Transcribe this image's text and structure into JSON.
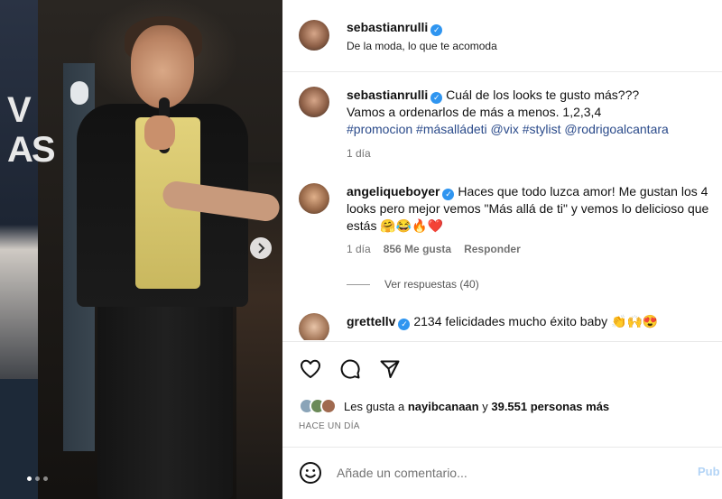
{
  "media": {
    "watermark": "V\nAS",
    "next_icon": "chevron-right-icon",
    "carousel_total": 3,
    "carousel_active": 1
  },
  "header": {
    "username": "sebastianrulli",
    "subtitle": "De la moda, lo que te acomoda"
  },
  "caption": {
    "username": "sebastianrulli",
    "text_1": "Cuál de los looks te gusto más???",
    "text_2": "Vamos a ordenarlos de más a menos. 1,2,3,4",
    "tags": "#promocion #másalládeti @vix #stylist @rodrigoalcantara",
    "time": "1 día"
  },
  "comment1": {
    "username": "angeliqueboyer",
    "text": "Haces que todo luzca amor! Me gustan los 4 looks pero mejor vemos \"Más allá de ti\" y vemos lo delicioso que estás 🤗😂🔥❤️",
    "time": "1 día",
    "likes": "856 Me gusta",
    "reply": "Responder",
    "view_replies": "Ver respuestas (40)"
  },
  "comment2": {
    "username": "grettellv",
    "text": "2134 felicidades mucho éxito baby 👏🙌😍"
  },
  "likes": {
    "prefix": "Les gusta a",
    "user": "nayibcanaan",
    "middle": "y",
    "count": "39.551 personas más"
  },
  "timestamp": "HACE UN DÍA",
  "comment_box": {
    "placeholder": "Añade un comentario...",
    "publish": "Pub"
  },
  "colors": {
    "verified": "#2f95f0",
    "hashtag": "#2a4a8a",
    "publish_disabled": "#b3d4f6"
  }
}
